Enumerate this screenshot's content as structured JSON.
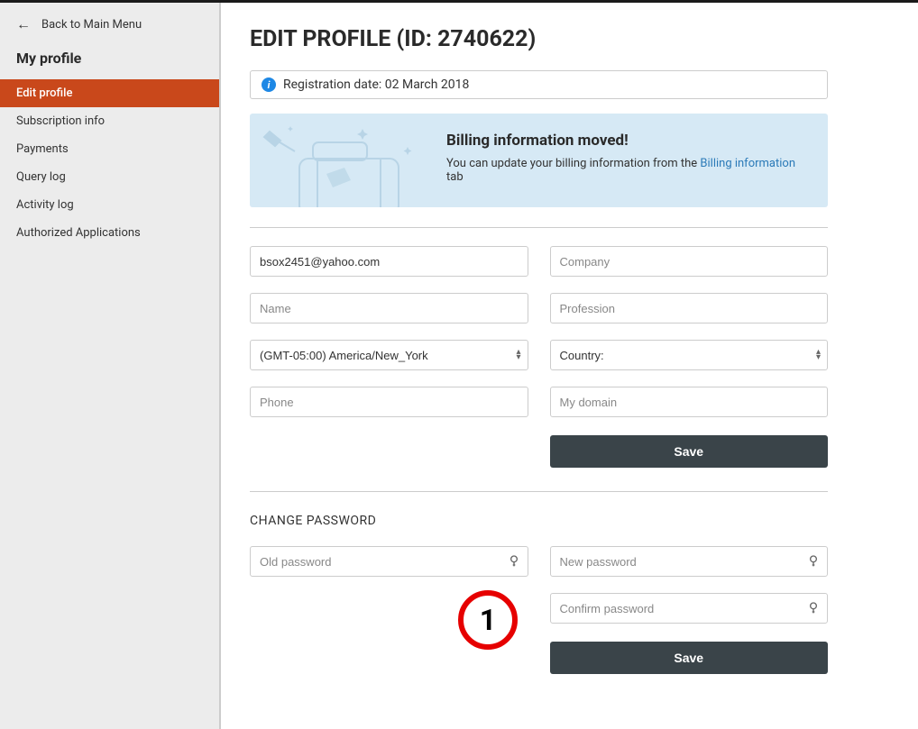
{
  "back_link": "Back to Main Menu",
  "sidebar": {
    "title": "My profile",
    "items": [
      {
        "label": "Edit profile",
        "active": true
      },
      {
        "label": "Subscription info",
        "active": false
      },
      {
        "label": "Payments",
        "active": false
      },
      {
        "label": "Query log",
        "active": false
      },
      {
        "label": "Activity log",
        "active": false
      },
      {
        "label": "Authorized Applications",
        "active": false
      }
    ]
  },
  "header": {
    "title": "EDIT PROFILE (ID: 2740622)"
  },
  "registration": {
    "text": "Registration date: 02 March 2018"
  },
  "billing_notice": {
    "heading": "Billing information moved!",
    "text_pre": "You can update your billing information from the ",
    "link": "Billing information",
    "text_post": " tab"
  },
  "form": {
    "email": {
      "value": "bsox2451@yahoo.com",
      "placeholder": ""
    },
    "company": {
      "value": "",
      "placeholder": "Company"
    },
    "name": {
      "value": "",
      "placeholder": "Name"
    },
    "profession": {
      "value": "",
      "placeholder": "Profession"
    },
    "timezone": {
      "value": "(GMT-05:00) America/New_York"
    },
    "country": {
      "value": "Country:"
    },
    "phone": {
      "value": "",
      "placeholder": "Phone"
    },
    "domain": {
      "value": "",
      "placeholder": "My domain"
    },
    "save_label": "Save"
  },
  "password_section": {
    "heading": "CHANGE PASSWORD",
    "old": {
      "placeholder": "Old password"
    },
    "new": {
      "placeholder": "New password"
    },
    "confirm": {
      "placeholder": "Confirm password"
    },
    "save_label": "Save"
  },
  "annotation": {
    "number": "1"
  }
}
